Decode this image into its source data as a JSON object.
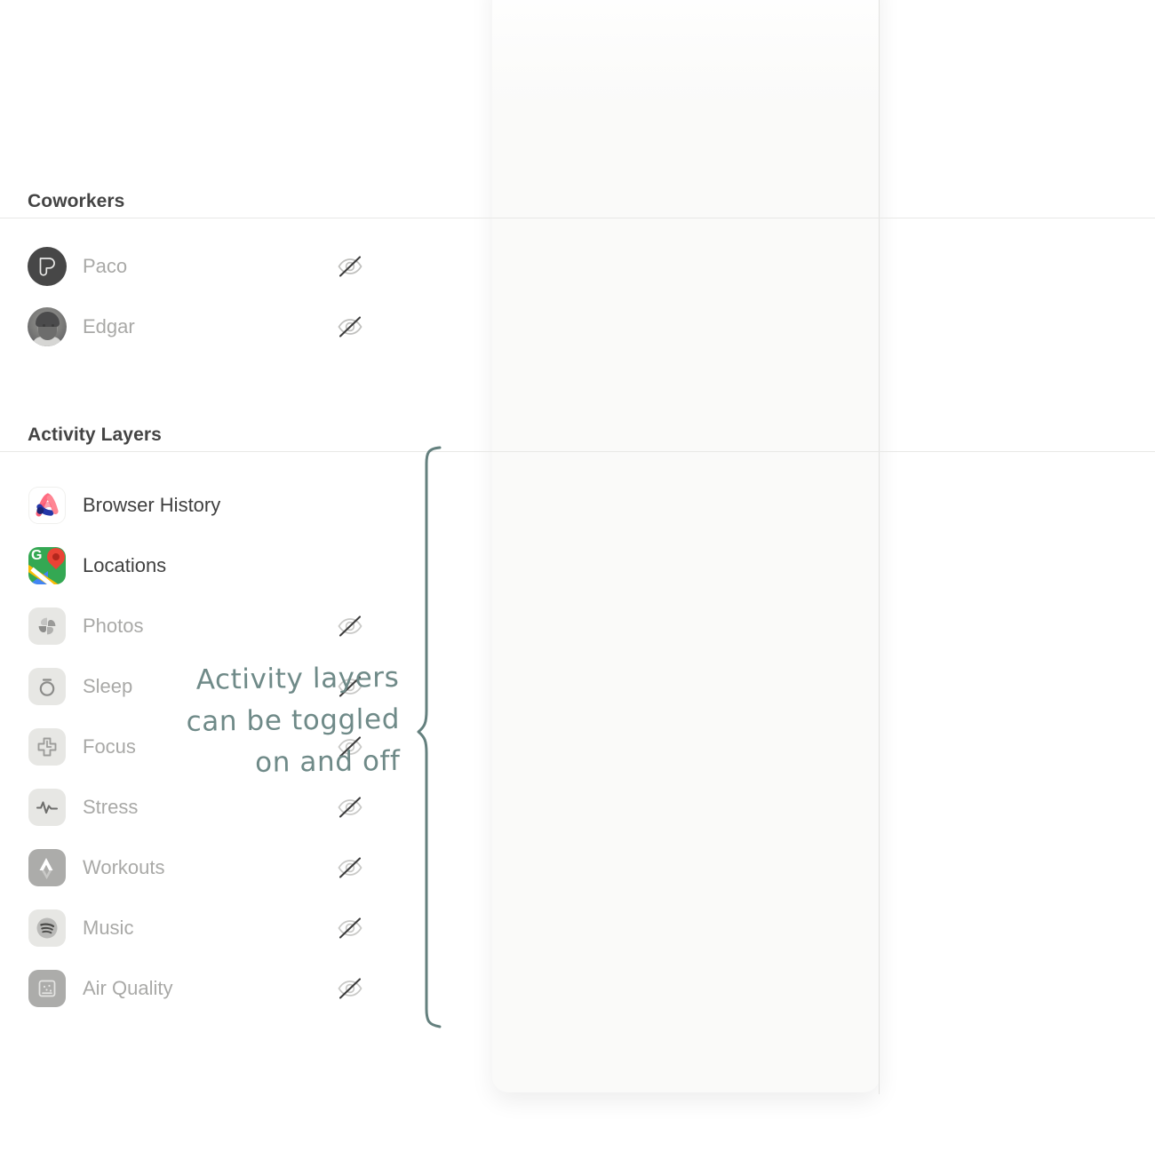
{
  "annotation": {
    "lines": [
      "Activity layers",
      "can be toggled",
      "on and off"
    ],
    "color": "#6f8a88"
  },
  "panel": {
    "background": "#fafaf9",
    "divider_color": "#e8e8e6"
  },
  "sections": [
    {
      "id": "coworkers",
      "title": "Coworkers",
      "items": [
        {
          "label": "Paco",
          "icon": "avatar-paco-icon",
          "visible": false,
          "toggle_icon": "eye-off-icon"
        },
        {
          "label": "Edgar",
          "icon": "avatar-edgar-icon",
          "visible": false,
          "toggle_icon": "eye-off-icon"
        }
      ]
    },
    {
      "id": "activity-layers",
      "title": "Activity Layers",
      "items": [
        {
          "label": "Browser History",
          "icon": "arc-browser-icon",
          "visible": true,
          "toggle_icon": ""
        },
        {
          "label": "Locations",
          "icon": "google-maps-icon",
          "visible": true,
          "toggle_icon": ""
        },
        {
          "label": "Photos",
          "icon": "google-photos-icon",
          "visible": false,
          "toggle_icon": "eye-off-icon"
        },
        {
          "label": "Sleep",
          "icon": "oura-ring-icon",
          "visible": false,
          "toggle_icon": "eye-off-icon"
        },
        {
          "label": "Focus",
          "icon": "focus-clock-icon",
          "visible": false,
          "toggle_icon": "eye-off-icon"
        },
        {
          "label": "Stress",
          "icon": "heart-rate-icon",
          "visible": false,
          "toggle_icon": "eye-off-icon"
        },
        {
          "label": "Workouts",
          "icon": "strava-icon",
          "visible": false,
          "toggle_icon": "eye-off-icon"
        },
        {
          "label": "Music",
          "icon": "spotify-icon",
          "visible": false,
          "toggle_icon": "eye-off-icon"
        },
        {
          "label": "Air Quality",
          "icon": "air-sensor-icon",
          "visible": false,
          "toggle_icon": "eye-off-icon"
        }
      ]
    }
  ]
}
